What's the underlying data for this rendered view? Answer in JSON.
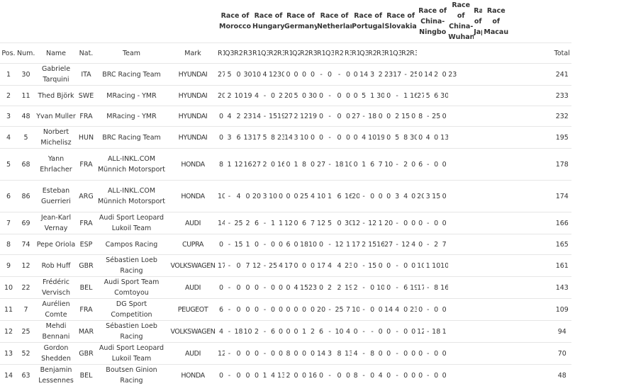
{
  "races": [
    {
      "label": "Race of Morocco",
      "cols": 2
    },
    {
      "label": "Race of Hungary",
      "cols": 4
    },
    {
      "label": "Race of Germany",
      "cols": 4
    },
    {
      "label": "Race of Netherlands",
      "cols": 3
    },
    {
      "label": "Race of Portugal",
      "cols": 4
    },
    {
      "label": "Race of Slovakia",
      "cols": 3
    },
    {
      "label": "Race of China-Ningbo",
      "cols": 4
    },
    {
      "label": "Race of China-Wuhan",
      "cols": 3
    },
    {
      "label": "Race of Japan",
      "cols": 1
    },
    {
      "label": "Race of Macau",
      "cols": 3
    }
  ],
  "headers": {
    "pos": "Pos.",
    "num": "Num.",
    "name": "Name",
    "nat": "Nat.",
    "team": "Team",
    "mark": "Mark",
    "total": "Total"
  },
  "sub_headers": [
    "R1",
    "Q3",
    "R2",
    "R3",
    "R1",
    "Q3",
    "R2",
    "R3",
    "R1",
    "Q2",
    "R2",
    "R3",
    "R1",
    "Q3",
    "R2",
    "R3",
    "R1",
    "Q3",
    "R2",
    "R3",
    "R1",
    "Q3",
    "R2",
    "R3",
    "",
    "",
    "",
    "",
    "",
    "",
    "",
    ""
  ],
  "rows": [
    {
      "pos": "1",
      "num": "30",
      "name": "Gabriele Tarquini",
      "nat": "ITA",
      "team": "BRC Racing Team",
      "mark": "HYUNDAI",
      "results": [
        "27",
        "5",
        "0",
        "30",
        "10",
        "4",
        "12",
        "30",
        "0",
        "0",
        "0",
        "0",
        "-",
        "0",
        "-",
        "0",
        "0",
        "14",
        "3",
        "2",
        "23",
        "17",
        "-",
        "25",
        "0",
        "14",
        "2",
        "0",
        "23",
        "",
        "",
        "",
        "",
        "",
        "",
        "",
        "",
        ""
      ],
      "total": "241"
    },
    {
      "pos": "2",
      "num": "11",
      "name": "Thed Björk",
      "nat": "SWE",
      "team": "MRacing - YMR",
      "mark": "HYUNDAI",
      "results": [
        "20",
        "2",
        "10",
        "19",
        "4",
        "-",
        "0",
        "2",
        "20",
        "5",
        "0",
        "30",
        "0",
        "-",
        "0",
        "0",
        "0",
        "5",
        "1",
        "30",
        "0",
        "-",
        "1",
        "16",
        "27",
        "5",
        "6",
        "30",
        "",
        "",
        "",
        "",
        "",
        "",
        "",
        "",
        ""
      ],
      "total": "233"
    },
    {
      "pos": "3",
      "num": "48",
      "name": "Yvan Muller",
      "nat": "FRA",
      "team": "MRacing - YMR",
      "mark": "HYUNDAI",
      "results": [
        "0",
        "4",
        "2",
        "23",
        "14",
        "-",
        "15",
        "19",
        "27",
        "2",
        "12",
        "19",
        "0",
        "-",
        "0",
        "0",
        "27",
        "-",
        "18",
        "0",
        "0",
        "2",
        "15",
        "0",
        "8",
        "-",
        "25",
        "0",
        "",
        "",
        "",
        "",
        "",
        "",
        "",
        "",
        ""
      ],
      "total": "232"
    },
    {
      "pos": "4",
      "num": "5",
      "name": "Norbert Michelisz",
      "nat": "HUN",
      "team": "BRC Racing Team",
      "mark": "HYUNDAI",
      "results": [
        "0",
        "3",
        "6",
        "13",
        "17",
        "5",
        "8",
        "23",
        "14",
        "3",
        "10",
        "0",
        "0",
        "-",
        "0",
        "0",
        "0",
        "4",
        "10",
        "19",
        "0",
        "5",
        "8",
        "30",
        "0",
        "4",
        "0",
        "13",
        "",
        "",
        "",
        "",
        "",
        "",
        "",
        "",
        ""
      ],
      "total": "195"
    },
    {
      "pos": "5",
      "num": "68",
      "name": "Yann Ehrlacher",
      "nat": "FRA",
      "team": "ALL-INKL.COM Münnich Motorsport",
      "mark": "HONDA",
      "results": [
        "8",
        "1",
        "12",
        "16",
        "27",
        "2",
        "0",
        "16",
        "0",
        "1",
        "8",
        "0",
        "27",
        "-",
        "18",
        "10",
        "0",
        "1",
        "6",
        "7",
        "10",
        "-",
        "2",
        "0",
        "6",
        "-",
        "0",
        "0",
        "",
        "",
        "",
        "",
        "",
        "",
        "",
        "",
        ""
      ],
      "total": "178"
    },
    {
      "pos": "6",
      "num": "86",
      "name": "Esteban Guerrieri",
      "nat": "ARG",
      "team": "ALL-INKL.COM Münnich Motorsport",
      "mark": "HONDA",
      "results": [
        "10",
        "-",
        "4",
        "0",
        "20",
        "3",
        "10",
        "0",
        "0",
        "0",
        "25",
        "4",
        "10",
        "1",
        "6",
        "16",
        "20",
        "-",
        "0",
        "0",
        "0",
        "3",
        "4",
        "0",
        "20",
        "3",
        "15",
        "0",
        "",
        "",
        "",
        "",
        "",
        "",
        "",
        "",
        ""
      ],
      "total": "174"
    },
    {
      "pos": "7",
      "num": "69",
      "name": "Jean-Karl Vernay",
      "nat": "FRA",
      "team": "Audi Sport Leopard Lukoil Team",
      "mark": "AUDI",
      "results": [
        "14",
        "-",
        "25",
        "2",
        "6",
        "-",
        "1",
        "1",
        "12",
        "0",
        "6",
        "7",
        "12",
        "5",
        "0",
        "30",
        "12",
        "-",
        "12",
        "1",
        "20",
        "-",
        "0",
        "0",
        "0",
        "-",
        "0",
        "0",
        "",
        "",
        "",
        "",
        "",
        "",
        "",
        "",
        ""
      ],
      "total": "166"
    },
    {
      "pos": "8",
      "num": "74",
      "name": "Pepe Oriola",
      "nat": "ESP",
      "team": "Campos Racing",
      "mark": "CUPRA",
      "results": [
        "0",
        "-",
        "15",
        "1",
        "0",
        "-",
        "0",
        "0",
        "6",
        "0",
        "18",
        "10",
        "0",
        "-",
        "12",
        "1",
        "17",
        "2",
        "15",
        "16",
        "27",
        "-",
        "12",
        "4",
        "0",
        "-",
        "2",
        "7",
        "",
        "",
        "",
        "",
        "",
        "",
        "",
        "",
        ""
      ],
      "total": "165"
    },
    {
      "pos": "9",
      "num": "12",
      "name": "Rob Huff",
      "nat": "GBR",
      "team": "Sébastien Loeb Racing",
      "mark": "VOLKSWAGEN",
      "results": [
        "17",
        "-",
        "0",
        "7",
        "12",
        "-",
        "25",
        "4",
        "17",
        "0",
        "0",
        "0",
        "17",
        "4",
        "4",
        "23",
        "0",
        "-",
        "15",
        "0",
        "0",
        "-",
        "0",
        "0",
        "10",
        "1",
        "10",
        "10",
        "",
        "",
        "",
        "",
        "",
        "",
        "",
        "",
        ""
      ],
      "total": "161"
    },
    {
      "pos": "10",
      "num": "22",
      "name": "Frédéric Vervisch",
      "nat": "BEL",
      "team": "Audi Sport Team Comtoyou",
      "mark": "AUDI",
      "results": [
        "0",
        "-",
        "0",
        "0",
        "0",
        "-",
        "0",
        "0",
        "0",
        "4",
        "15",
        "23",
        "0",
        "2",
        "2",
        "19",
        "2",
        "-",
        "0",
        "10",
        "0",
        "-",
        "6",
        "19",
        "17",
        "-",
        "8",
        "16",
        "",
        "",
        "",
        "",
        "",
        "",
        "",
        "",
        ""
      ],
      "total": "143"
    },
    {
      "pos": "11",
      "num": "7",
      "name": "Aurélien Comte",
      "nat": "FRA",
      "team": "DG Sport Competition",
      "mark": "PEUGEOT",
      "results": [
        "6",
        "-",
        "0",
        "0",
        "0",
        "-",
        "0",
        "0",
        "0",
        "0",
        "0",
        "0",
        "20",
        "-",
        "25",
        "7",
        "10",
        "-",
        "0",
        "0",
        "14",
        "4",
        "0",
        "23",
        "0",
        "-",
        "0",
        "0",
        "",
        "",
        "",
        "",
        "",
        "",
        "",
        "",
        ""
      ],
      "total": "109"
    },
    {
      "pos": "12",
      "num": "25",
      "name": "Mehdi Bennani",
      "nat": "MAR",
      "team": "Sébastien Loeb Racing",
      "mark": "VOLKSWAGEN",
      "results": [
        "4",
        "-",
        "18",
        "10",
        "2",
        "-",
        "6",
        "0",
        "0",
        "0",
        "1",
        "2",
        "6",
        "-",
        "10",
        "4",
        "0",
        "-",
        "-",
        "0",
        "0",
        "-",
        "0",
        "0",
        "12",
        "-",
        "18",
        "1",
        "",
        "",
        "",
        "",
        "",
        "",
        "",
        "",
        ""
      ],
      "total": "94"
    },
    {
      "pos": "13",
      "num": "52",
      "name": "Gordon Shedden",
      "nat": "GBR",
      "team": "Audi Sport Leopard Lukoil Team",
      "mark": "AUDI",
      "results": [
        "12",
        "-",
        "0",
        "0",
        "0",
        "-",
        "0",
        "0",
        "8",
        "0",
        "0",
        "0",
        "14",
        "3",
        "8",
        "13",
        "4",
        "-",
        "8",
        "0",
        "0",
        "-",
        "0",
        "0",
        "0",
        "-",
        "0",
        "0",
        "",
        "",
        "",
        "",
        "",
        "",
        "",
        "",
        ""
      ],
      "total": "70"
    },
    {
      "pos": "14",
      "num": "63",
      "name": "Benjamin Lessennes",
      "nat": "BEL",
      "team": "Boutsen Ginion Racing",
      "mark": "HONDA",
      "results": [
        "0",
        "-",
        "0",
        "0",
        "0",
        "1",
        "4",
        "13",
        "2",
        "0",
        "0",
        "16",
        "0",
        "-",
        "0",
        "0",
        "8",
        "-",
        "0",
        "4",
        "0",
        "-",
        "0",
        "0",
        "0",
        "-",
        "0",
        "0",
        "",
        "",
        "",
        "",
        "",
        "",
        "",
        "",
        ""
      ],
      "total": "48"
    }
  ]
}
